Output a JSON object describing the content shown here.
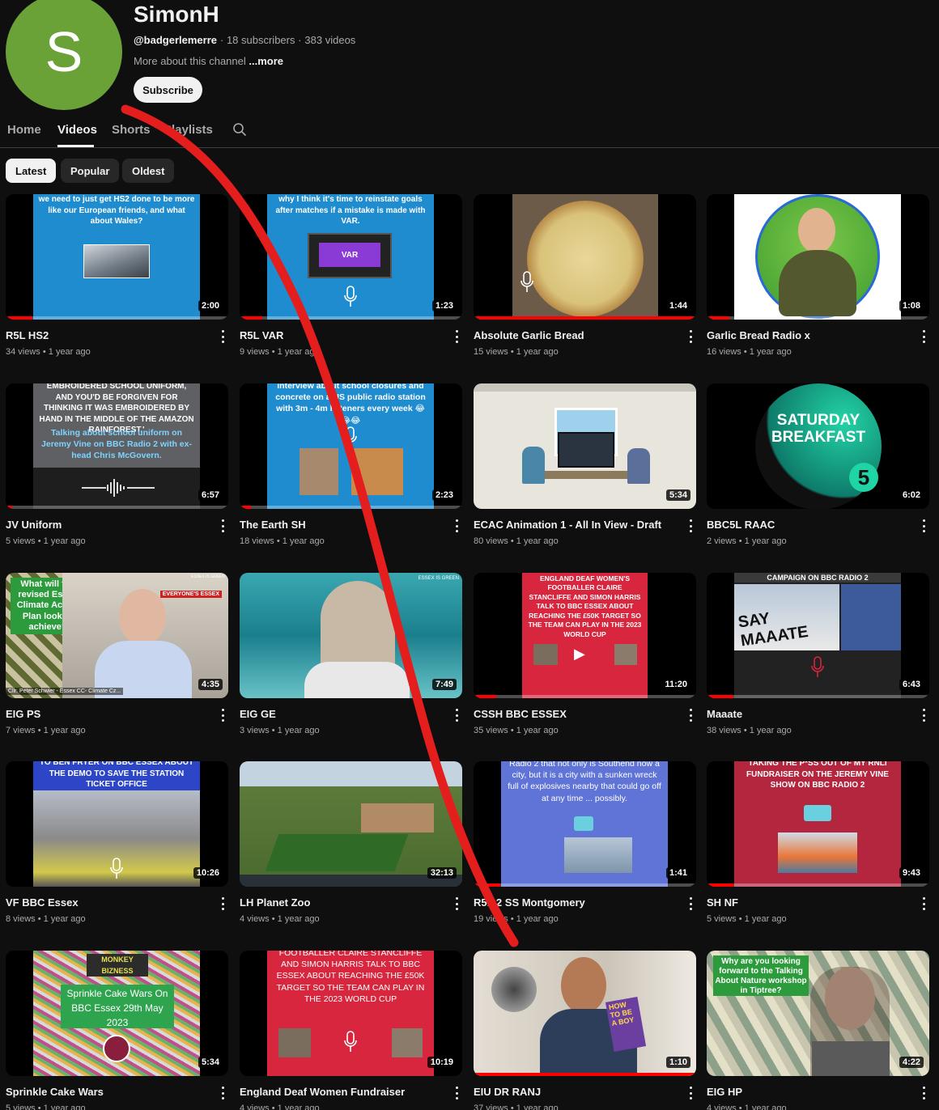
{
  "channel": {
    "avatar_letter": "S",
    "name": "SimonH",
    "handle": "@badgerlemerre",
    "subscribers": "· 18 subscribers ·",
    "videos_count": "383 videos",
    "about_prefix": "More about this channel",
    "about_more": "...more",
    "subscribe_label": "Subscribe",
    "avatar_color": "#6aa237"
  },
  "tabs": [
    {
      "label": "Home"
    },
    {
      "label": "Videos"
    },
    {
      "label": "Shorts"
    },
    {
      "label": "Playlists"
    }
  ],
  "chips": [
    {
      "label": "Latest"
    },
    {
      "label": "Popular"
    },
    {
      "label": "Oldest"
    }
  ],
  "videos": [
    {
      "title": "R5L HS2",
      "views": "34 views",
      "age": "1 year ago",
      "duration": "2:00",
      "progress": 0.12,
      "thumb_text": "we need to just get HS2 done to be more like our European friends, and what about Wales?"
    },
    {
      "title": "R5L VAR",
      "views": "9 views",
      "age": "1 year ago",
      "duration": "1:23",
      "progress": 0.1,
      "thumb_text": "why I think it's time to reinstate goals after matches if a mistake is made with VAR.",
      "thumb_label": "VAR"
    },
    {
      "title": "Absolute Garlic Bread",
      "views": "15 views",
      "age": "1 year ago",
      "duration": "1:44",
      "progress": 1.0
    },
    {
      "title": "Garlic Bread Radio x",
      "views": "16 views",
      "age": "1 year ago",
      "duration": "1:08",
      "progress": 0.1
    },
    {
      "title": "JV Uniform",
      "views": "5 views",
      "age": "1 year ago",
      "duration": "6:57",
      "progress": 0.03,
      "thumb_text": "EMBROIDERED SCHOOL UNIFORM, AND YOU'D BE FORGIVEN FOR THINKING IT WAS EMBROIDERED BY HAND IN THE MIDDLE OF THE AMAZON RAINFOREST.'",
      "thumb_text2": "Talking about school uniform on Jeremy Vine on BBC Radio 2 with ex-head Chris McGovern."
    },
    {
      "title": "The Earth SH",
      "views": "18 views",
      "age": "1 year ago",
      "duration": "2:23",
      "progress": 0.05,
      "thumb_text": "interview about school closures and concrete on a US public radio station with 3m - 4m listeners every week 😂😂😂"
    },
    {
      "title": "ECAC Animation 1 - All In View - Draft",
      "views": "80 views",
      "age": "1 year ago",
      "duration": "5:34",
      "progress": 0.0
    },
    {
      "title": "BBC5L RAAC",
      "views": "2 views",
      "age": "1 year ago",
      "duration": "6:02",
      "progress": 0.0,
      "thumb_text": "SATURDAY BREAKFAST",
      "thumb_badge": "5"
    },
    {
      "title": "EIG PS",
      "views": "7 views",
      "age": "1 year ago",
      "duration": "4:35",
      "progress": 0.0,
      "thumb_text": "What will the revised Essex Climate Action Plan look to achieve?",
      "thumb_caption": "Cllr. Peter Schwier - Essex CC- Climate Cz...",
      "thumb_corner": "EVERYONE'S ESSEX",
      "thumb_logo": "ESSEX IS GREEN"
    },
    {
      "title": "EIG GE",
      "views": "3 views",
      "age": "1 year ago",
      "duration": "7:49",
      "progress": 0.0,
      "thumb_logo": "ESSEX IS GREEN"
    },
    {
      "title": "CSSH BBC ESSEX",
      "views": "35 views",
      "age": "1 year ago",
      "duration": "11:20",
      "progress": 0.1,
      "thumb_text": "ENGLAND DEAF WOMEN'S FOOTBALLER CLAIRE STANCLIFFE AND SIMON HARRIS TALK TO BBC ESSEX ABOUT REACHING THE £50K TARGET SO THE TEAM CAN PLAY IN THE 2023 WORLD CUP"
    },
    {
      "title": "Maaate",
      "views": "38 views",
      "age": "1 year ago",
      "duration": "6:43",
      "progress": 0.12,
      "thumb_text": "CAMPAIGN ON BBC RADIO 2",
      "thumb_sign": "SAY MAAATE"
    },
    {
      "title": "VF BBC Essex",
      "views": "8 views",
      "age": "1 year ago",
      "duration": "10:26",
      "progress": 0.0,
      "thumb_text": "TO BEN FRYER ON BBC ESSEX ABOUT THE DEMO TO SAVE THE STATION TICKET OFFICE"
    },
    {
      "title": "LH Planet Zoo",
      "views": "4 views",
      "age": "1 year ago",
      "duration": "32:13",
      "progress": 0.0
    },
    {
      "title": "R5L 2 SS Montgomery",
      "views": "19 views",
      "age": "1 year ago",
      "duration": "1:41",
      "progress": 0.12,
      "thumb_text": "Radio 2 that not only is Southend now a city, but it is a city with a sunken wreck full of explosives nearby that could go off at any time ... possibly."
    },
    {
      "title": "SH NF",
      "views": "5 views",
      "age": "1 year ago",
      "duration": "9:43",
      "progress": 0.12,
      "thumb_text": "TAKING THE P*SS OUT OF MY RNLI FUNDRAISER ON THE JEREMY VINE SHOW ON BBC RADIO 2"
    },
    {
      "title": "Sprinkle Cake Wars",
      "views": "5 views",
      "age": "1 year ago",
      "duration": "5:34",
      "progress": 0.0,
      "thumb_text": "Sprinkle Cake Wars On BBC Essex 29th May 2023",
      "thumb_logo": "MONKEY BIZNESS"
    },
    {
      "title": "England Deaf Women Fundraiser",
      "views": "4 views",
      "age": "1 year ago",
      "duration": "10:19",
      "progress": 0.0,
      "thumb_text": "FOOTBALLER CLAIRE STANCLIFFE AND SIMON HARRIS TALK TO BBC ESSEX ABOUT REACHING THE £50K TARGET SO THE TEAM CAN PLAY IN THE 2023 WORLD CUP"
    },
    {
      "title": "EIU DR RANJ",
      "views": "37 views",
      "age": "1 year ago",
      "duration": "1:10",
      "progress": 1.0,
      "thumb_book": "HOW TO BE A BOY"
    },
    {
      "title": "EIG HP",
      "views": "4 views",
      "age": "1 year ago",
      "duration": "4:22",
      "progress": 0.0,
      "thumb_text": "Why are you looking forward to the Talking About Nature workshop in Tiptree?"
    }
  ]
}
